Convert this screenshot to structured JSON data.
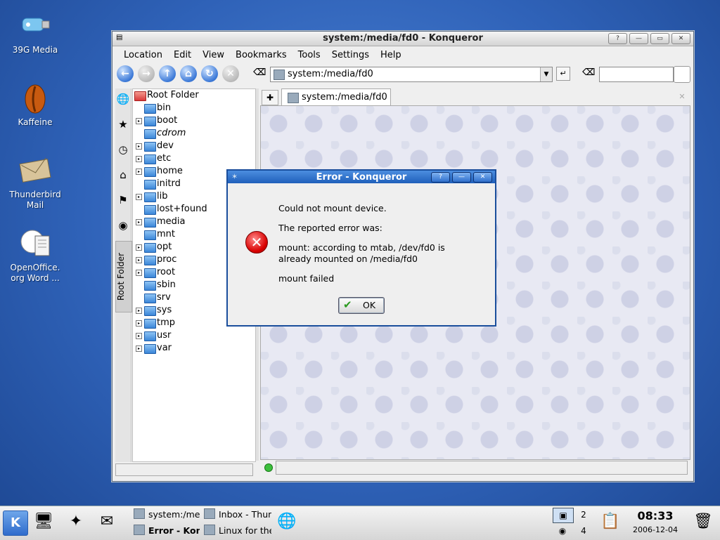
{
  "desktop": {
    "icons": [
      {
        "label_lines": [
          "39G Media"
        ],
        "icon": "usb-drive-icon"
      },
      {
        "label_lines": [
          "Kaffeine"
        ],
        "icon": "kaffeine-icon"
      },
      {
        "label_lines": [
          "Thunderbird",
          "Mail"
        ],
        "icon": "mail-envelope-icon"
      },
      {
        "label_lines": [
          "OpenOffice.",
          "org Word ..."
        ],
        "icon": "document-icon"
      }
    ]
  },
  "window": {
    "title": "system:/media/fd0 - Konqueror",
    "title_buttons": [
      "?",
      "—",
      "▭",
      "✕"
    ],
    "menu": [
      "Location",
      "Edit",
      "View",
      "Bookmarks",
      "Tools",
      "Settings",
      "Help"
    ],
    "url": "system:/media/fd0",
    "search_value": "",
    "sidebar_vertical_tab": "Root Folder",
    "tree": {
      "root": "Root Folder",
      "items": [
        {
          "label": "bin",
          "expandable": false
        },
        {
          "label": "boot",
          "expandable": true
        },
        {
          "label": "cdrom",
          "expandable": false,
          "italic": true
        },
        {
          "label": "dev",
          "expandable": true
        },
        {
          "label": "etc",
          "expandable": true
        },
        {
          "label": "home",
          "expandable": true
        },
        {
          "label": "initrd",
          "expandable": false
        },
        {
          "label": "lib",
          "expandable": true
        },
        {
          "label": "lost+found",
          "expandable": false
        },
        {
          "label": "media",
          "expandable": true
        },
        {
          "label": "mnt",
          "expandable": false
        },
        {
          "label": "opt",
          "expandable": true
        },
        {
          "label": "proc",
          "expandable": true
        },
        {
          "label": "root",
          "expandable": true
        },
        {
          "label": "sbin",
          "expandable": false
        },
        {
          "label": "srv",
          "expandable": false
        },
        {
          "label": "sys",
          "expandable": true
        },
        {
          "label": "tmp",
          "expandable": true
        },
        {
          "label": "usr",
          "expandable": true
        },
        {
          "label": "var",
          "expandable": true
        }
      ]
    },
    "tab_label": "system:/media/fd0",
    "status_text": ""
  },
  "dialog": {
    "title": "Error - Konqueror",
    "title_buttons": [
      "?",
      "—",
      "✕"
    ],
    "line1": "Could not mount device.",
    "line2": "The reported error was:",
    "line3a": "mount: according to mtab, /dev/fd0 is",
    "line3b": "already mounted on /media/fd0",
    "line4": "mount failed",
    "ok_label": "OK"
  },
  "taskbar": {
    "tasks": [
      {
        "label": "system:/me"
      },
      {
        "label": "Inbox - Thun"
      },
      {
        "label": "Error - Kon"
      },
      {
        "label": "Linux for the"
      }
    ],
    "pager": [
      "2",
      "4"
    ],
    "time": "08:33",
    "date": "2006-12-04"
  }
}
